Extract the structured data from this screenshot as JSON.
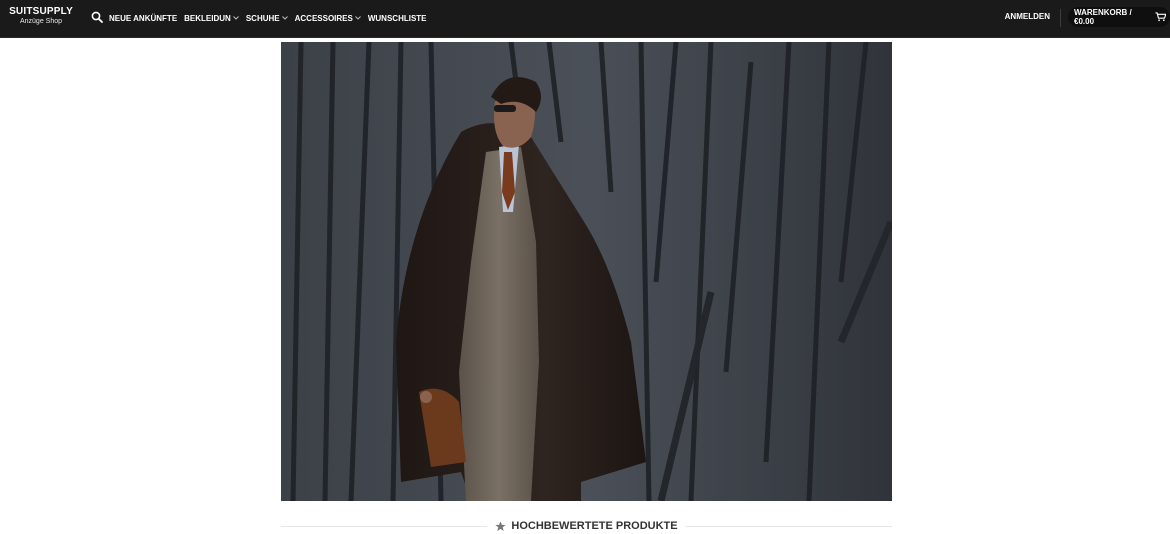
{
  "header": {
    "logo": {
      "brand": "SUITSUPPLY",
      "tagline": "Anzüge Shop"
    },
    "search_icon": "search-icon",
    "nav": [
      {
        "label": "NEUE ANKÜNFTE",
        "dropdown": false
      },
      {
        "label": "BEKLEIDUN",
        "dropdown": true
      },
      {
        "label": "SCHUHE",
        "dropdown": true
      },
      {
        "label": "ACCESSOIRES",
        "dropdown": true
      },
      {
        "label": "WUNSCHLISTE",
        "dropdown": false
      }
    ],
    "login_label": "ANMELDEN",
    "cart_label": "WARENKORB / €0.00",
    "cart_icon": "cart-icon"
  },
  "hero": {
    "description_icon": "photo-man-in-overcoat"
  },
  "section": {
    "icon": "star-icon",
    "heading": "HOCHBEWERTETE PRODUKTE"
  },
  "colors": {
    "header_bg": "#1a1a1a",
    "header_text": "#ffffff",
    "heading_text": "#333333",
    "divider": "#e6e6e6"
  }
}
